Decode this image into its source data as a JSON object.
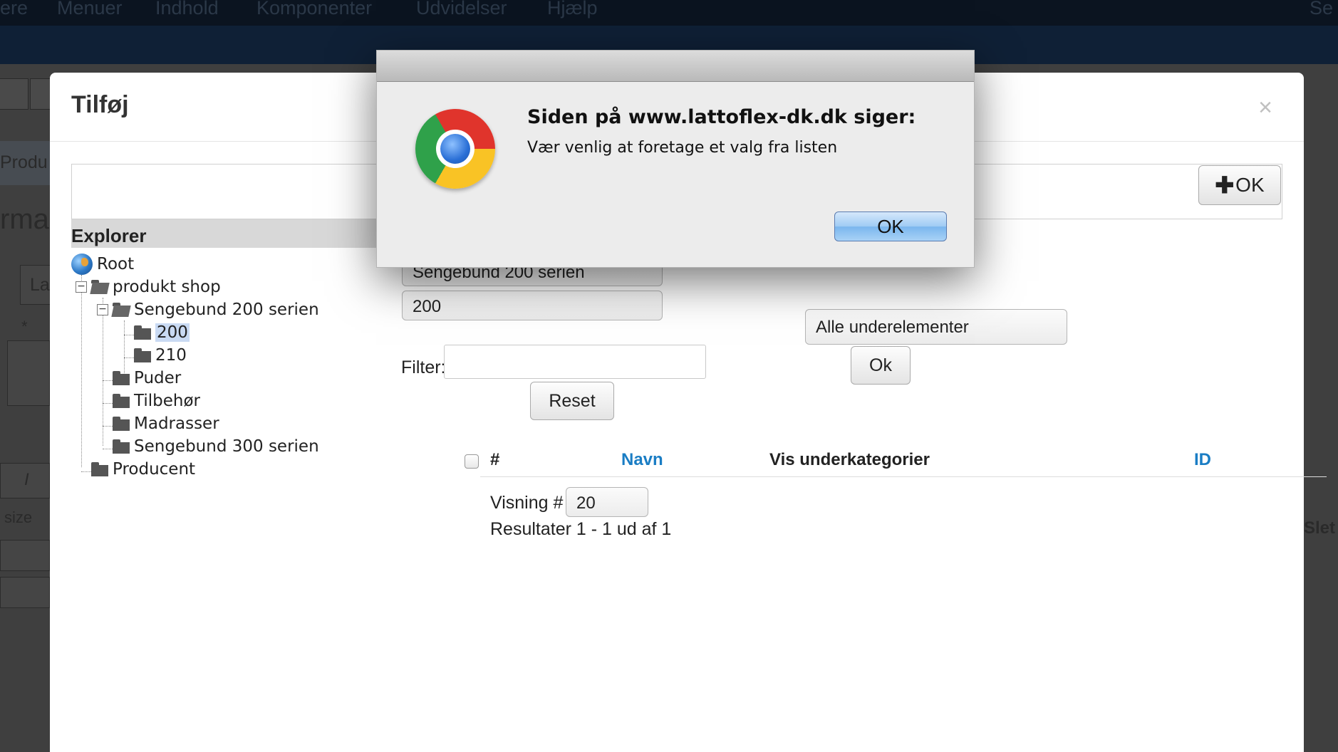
{
  "background": {
    "top_menu": [
      "ere",
      "Menuer",
      "Indhold",
      "Komponenter",
      "Udvidelser",
      "Hjælp",
      "Se"
    ],
    "side_texts": [
      "Produ",
      "rma",
      "La",
      "*",
      "I",
      "size",
      "Slet"
    ]
  },
  "modal": {
    "title": "Tilføj",
    "close_glyph": "×",
    "add_ok_button": "OK",
    "explorer_header": "Explorer",
    "tree": {
      "root": "Root",
      "shop": "produkt shop",
      "seng200": "Sengebund 200 serien",
      "c200": "200",
      "c210": "210",
      "puder": "Puder",
      "tilbehor": "Tilbehør",
      "madrasser": "Madrasser",
      "seng300": "Sengebund 300 serien",
      "producent": "Producent"
    },
    "dropdown_category": "Sengebund 200 serien",
    "dropdown_sub": "200",
    "dropdown_scope": "Alle underelementer",
    "filter_label": "Filter:",
    "filter_value": "",
    "filter_ok": "Ok",
    "reset": "Reset",
    "table": {
      "col_hash": "#",
      "col_name": "Navn",
      "col_sub": "Vis underkategorier",
      "col_id": "ID"
    },
    "visning_label": "Visning #",
    "visning_value": "20",
    "results": "Resultater 1 - 1 ud af 1"
  },
  "alert": {
    "title": "Siden på www.lattoflex-dk.dk siger:",
    "message": "Vær venlig at foretage et valg fra listen",
    "ok": "OK"
  },
  "colors": {
    "link": "#1a7dc4",
    "selected": "#c9daf3",
    "alert_button": "#7ab6ee"
  }
}
